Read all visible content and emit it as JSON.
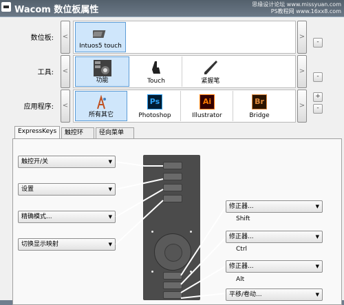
{
  "window": {
    "title": "Wacom 数位板属性",
    "watermark_line1": "思缘设计论坛 www.missyuan.com",
    "watermark_line2": "PS教程网 www.16xx8.com"
  },
  "rows": {
    "tablet": {
      "label": "数位板:",
      "items": [
        {
          "label": "Intuos5 touch",
          "icon": "tablet-icon"
        }
      ]
    },
    "tool": {
      "label": "工具:",
      "items": [
        {
          "label": "功能",
          "icon": "function-icon"
        },
        {
          "label": "Touch",
          "icon": "touch-icon"
        },
        {
          "label": "紧握笔",
          "icon": "grip-pen-icon"
        }
      ]
    },
    "app": {
      "label": "应用程序:",
      "items": [
        {
          "label": "所有其它",
          "icon": "all-apps-icon"
        },
        {
          "label": "Photoshop",
          "icon": "photoshop-icon",
          "glyph": "Ps"
        },
        {
          "label": "Illustrator",
          "icon": "illustrator-icon",
          "glyph": "Ai"
        },
        {
          "label": "Bridge",
          "icon": "bridge-icon",
          "glyph": "Br"
        }
      ]
    }
  },
  "buttons": {
    "prev": "<",
    "next": ">",
    "minus": "-",
    "plus": "+"
  },
  "tabs": [
    "ExpressKeys",
    "触控环",
    "径向菜单"
  ],
  "expresskeys": {
    "left": [
      "触控开/关",
      "设置",
      "精确模式...",
      "切换显示映射"
    ],
    "right": [
      {
        "value": "修正器...",
        "sub": "Shift"
      },
      {
        "value": "修正器...",
        "sub": "Ctrl"
      },
      {
        "value": "修正器...",
        "sub": "Alt"
      },
      {
        "value": "平移/卷动..."
      }
    ]
  },
  "colors": {
    "ps": "#001d34",
    "ps_fg": "#2fa3f7",
    "ai": "#330000",
    "ai_fg": "#ff7c00",
    "br": "#2b1400",
    "br_fg": "#e08a3c"
  }
}
